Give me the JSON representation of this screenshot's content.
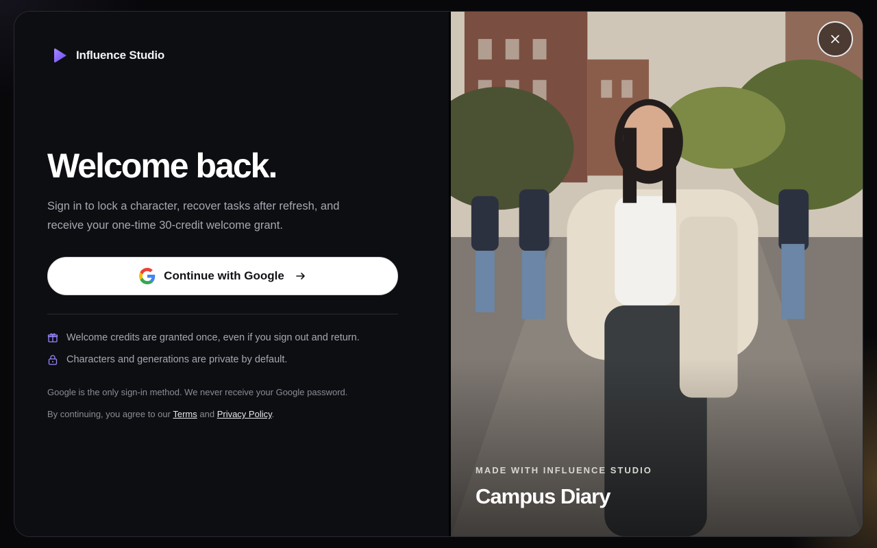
{
  "brand": {
    "name": "Influence Studio",
    "icon": "play-logo-icon",
    "accent": "#7c5cff"
  },
  "signin": {
    "title": "Welcome back.",
    "subtitle": "Sign in to lock a character, recover tasks after refresh, and receive your one-time 30-credit welcome grant.",
    "google_button_label": "Continue with Google",
    "perks": [
      {
        "icon": "gift-icon",
        "text": "Welcome credits are granted once, even if you sign out and return."
      },
      {
        "icon": "lock-icon",
        "text": "Characters and generations are private by default."
      }
    ],
    "note_google": "Google is the only sign-in method. We never receive your Google password.",
    "legal": {
      "prefix": "By continuing, you agree to our",
      "terms": "Terms",
      "and": "and",
      "privacy": "Privacy Policy",
      "suffix": "."
    }
  },
  "showcase": {
    "eyebrow": "MADE WITH INFLUENCE STUDIO",
    "caption": "Campus Diary",
    "close_icon": "close-icon"
  }
}
